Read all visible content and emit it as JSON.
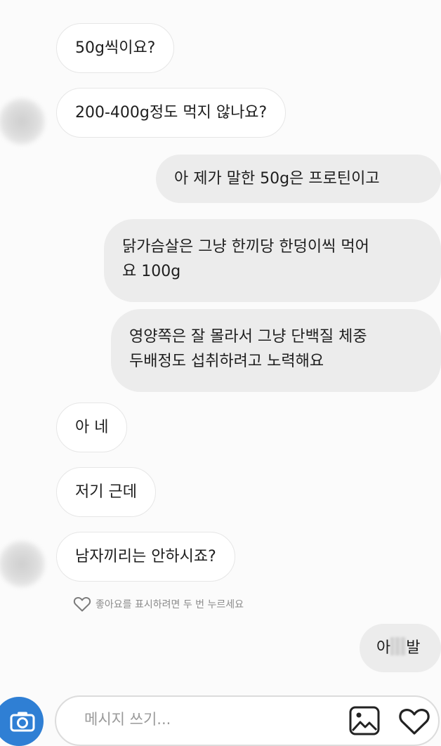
{
  "messages": [
    {
      "side": "in",
      "text": "50g씩이요?"
    },
    {
      "side": "in",
      "text": "200-400g정도 먹지 않나요?"
    },
    {
      "side": "out",
      "text": "아 제가 말한 50g은 프로틴이고"
    },
    {
      "side": "out",
      "line1": "닭가슴살은 그냥 한끼당 한덩이씩 먹어",
      "line2": "요 100g"
    },
    {
      "side": "out",
      "line1": "영양쪽은 잘 몰라서 그냥 단백질 체중",
      "line2": "두배정도 섭취하려고 노력해요"
    },
    {
      "side": "in",
      "text": "아 네"
    },
    {
      "side": "in",
      "text": "저기 근데"
    },
    {
      "side": "in",
      "text": "남자끼리는 안하시죠?"
    },
    {
      "side": "out",
      "prefix": "아",
      "suffix": "발"
    }
  ],
  "like_hint": "좋아요를 표시하려면 두 번 누르세요",
  "composer": {
    "placeholder": "메시지 쓰기..."
  },
  "icons": {
    "camera": "camera-icon",
    "gallery": "gallery-icon",
    "heart": "heart-icon",
    "like": "heart-outline-icon"
  },
  "colors": {
    "camera_button": "#2f7fd4",
    "outgoing_bubble": "#ececec",
    "incoming_border": "#e6e6e6"
  }
}
